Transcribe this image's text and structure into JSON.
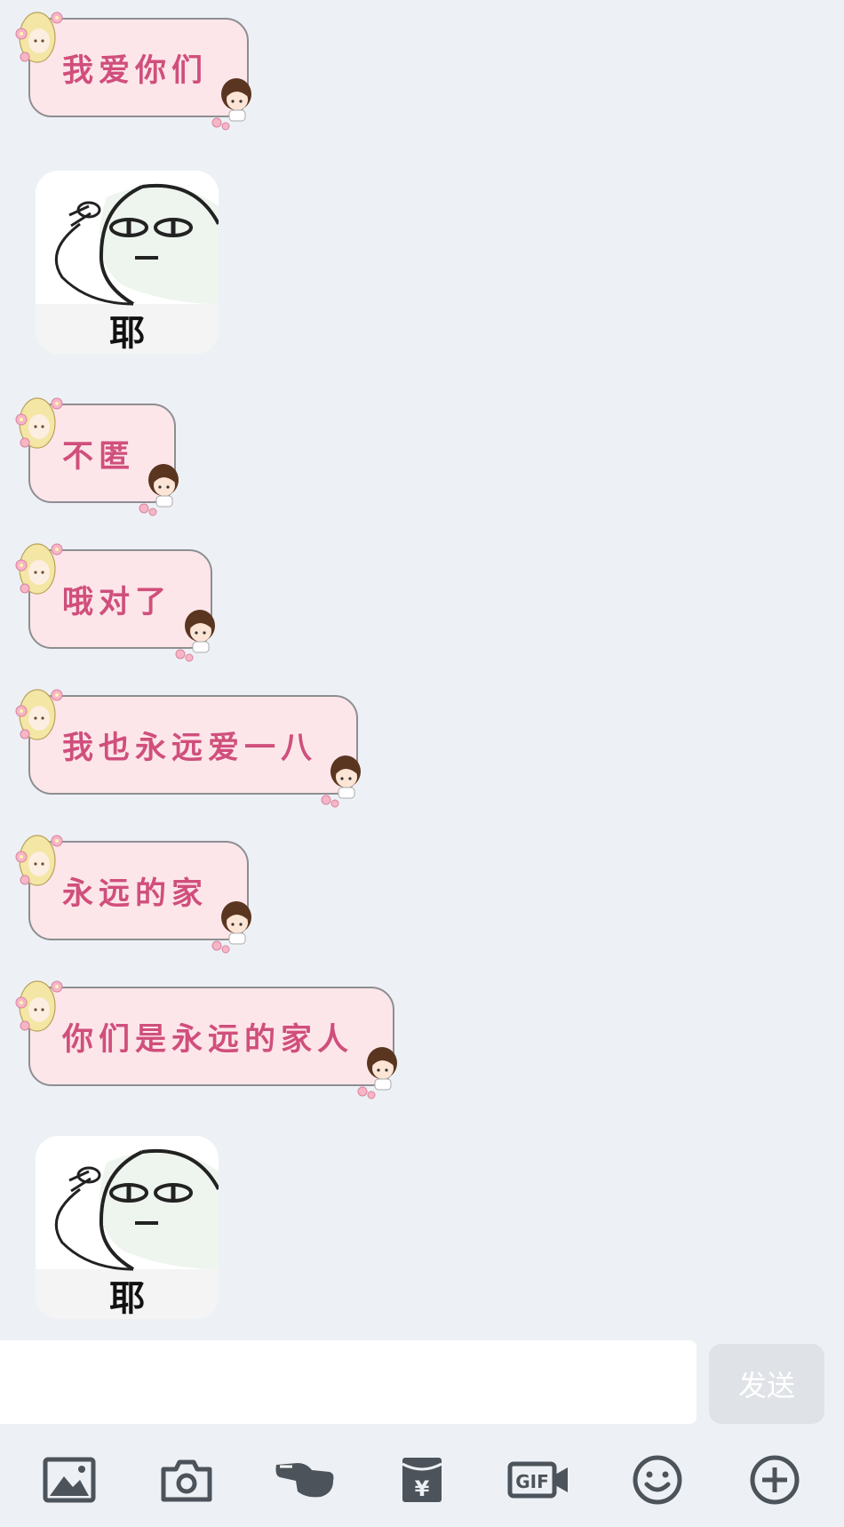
{
  "messages": [
    {
      "type": "text",
      "text": "我爱你们"
    },
    {
      "type": "sticker",
      "caption": "耶"
    },
    {
      "type": "text",
      "text": "不匿"
    },
    {
      "type": "text",
      "text": "哦对了"
    },
    {
      "type": "text",
      "text": "我也永远爱一八"
    },
    {
      "type": "text",
      "text": "永远的家"
    },
    {
      "type": "text",
      "text": "你们是永远的家人"
    },
    {
      "type": "sticker",
      "caption": "耶"
    }
  ],
  "composer": {
    "value": "",
    "placeholder": "",
    "send_label": "发送"
  },
  "toolbar": {
    "icons": [
      "image-icon",
      "camera-icon",
      "voice-icon",
      "red-packet-icon",
      "gif-icon",
      "emoji-icon",
      "plus-icon"
    ],
    "gif_label": "GIF",
    "red_packet_symbol": "¥"
  },
  "colors": {
    "bubble_bg": "#fde6ea",
    "bubble_text": "#d04f7c",
    "chat_bg": "#edf1f5",
    "icon": "#4c535a"
  }
}
